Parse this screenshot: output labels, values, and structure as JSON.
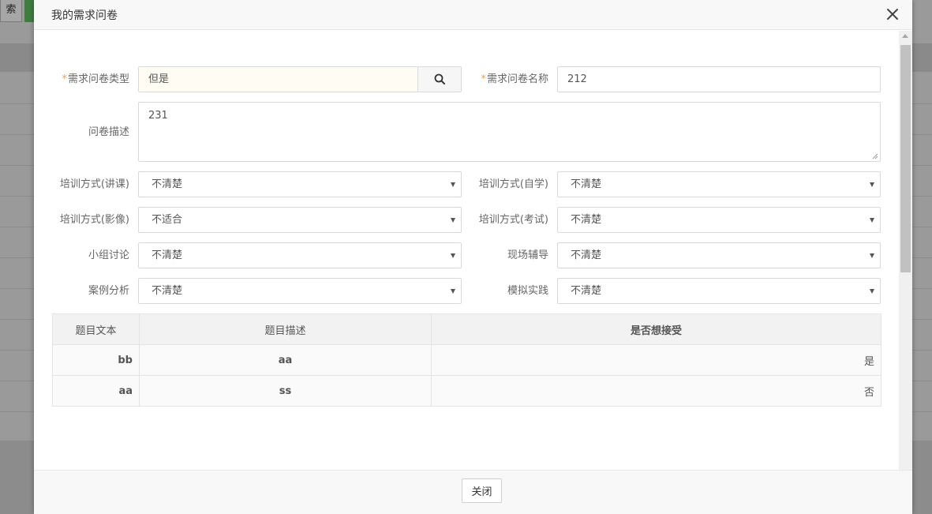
{
  "background": {
    "search_button_label": "索"
  },
  "modal": {
    "title": "我的需求问卷",
    "close_button_label": "关闭"
  },
  "form": {
    "survey_type": {
      "label": "需求问卷类型",
      "required_mark": "*",
      "value": "但是"
    },
    "survey_name": {
      "label": "需求问卷名称",
      "required_mark": "*",
      "value": "212"
    },
    "description": {
      "label": "问卷描述",
      "value": "231"
    },
    "selects": [
      {
        "label": "培训方式(讲课)",
        "value": "不清楚"
      },
      {
        "label": "培训方式(自学)",
        "value": "不清楚"
      },
      {
        "label": "培训方式(影像)",
        "value": "不适合"
      },
      {
        "label": "培训方式(考试)",
        "value": "不清楚"
      },
      {
        "label": "小组讨论",
        "value": "不清楚"
      },
      {
        "label": "现场辅导",
        "value": "不清楚"
      },
      {
        "label": "案例分析",
        "value": "不清楚"
      },
      {
        "label": "模拟实践",
        "value": "不清楚"
      }
    ]
  },
  "table": {
    "headers": [
      "题目文本",
      "题目描述",
      "是否想接受"
    ],
    "rows": [
      [
        "bb",
        "aa",
        "是"
      ],
      [
        "aa",
        "ss",
        "否"
      ]
    ]
  },
  "colors": {
    "required": "#e8a54b",
    "border": "#d9d9d9",
    "header_bg": "#f8f8f8"
  }
}
